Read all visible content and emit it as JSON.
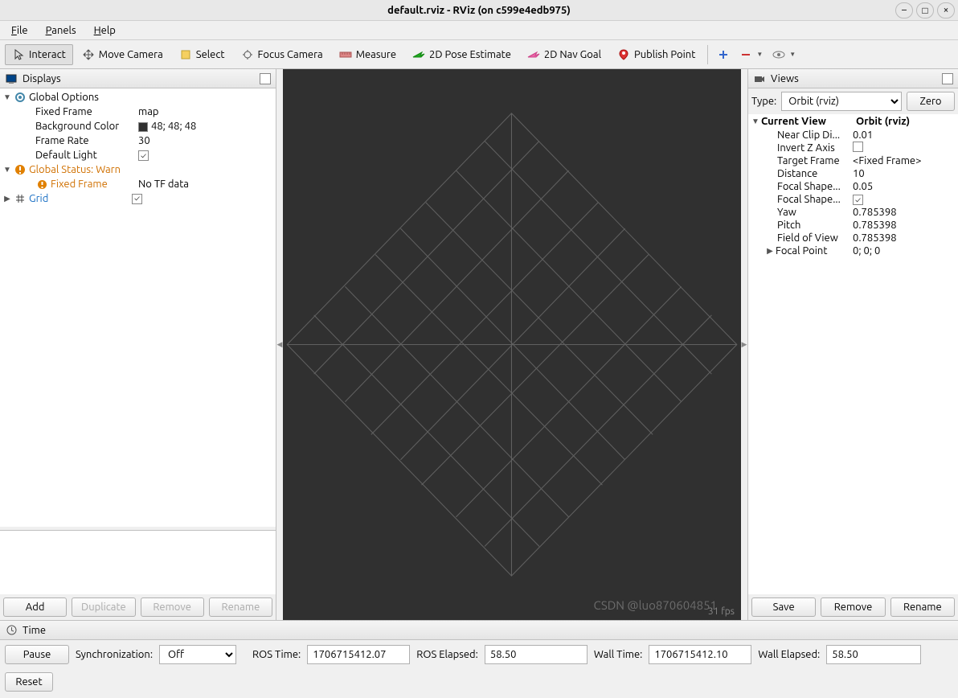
{
  "window": {
    "title": "default.rviz - RViz (on c599e4edb975)"
  },
  "menus": {
    "file": "File",
    "panels": "Panels",
    "help": "Help"
  },
  "toolbar": {
    "interact": "Interact",
    "move_camera": "Move Camera",
    "select": "Select",
    "focus_camera": "Focus Camera",
    "measure": "Measure",
    "pose_estimate": "2D Pose Estimate",
    "nav_goal": "2D Nav Goal",
    "publish_point": "Publish Point"
  },
  "displays": {
    "panel_title": "Displays",
    "global_options": {
      "label": "Global Options",
      "fixed_frame": {
        "label": "Fixed Frame",
        "value": "map"
      },
      "background_color": {
        "label": "Background Color",
        "value": "48; 48; 48"
      },
      "frame_rate": {
        "label": "Frame Rate",
        "value": "30"
      },
      "default_light": {
        "label": "Default Light",
        "checked": true
      }
    },
    "global_status": {
      "label": "Global Status: Warn",
      "fixed_frame": {
        "label": "Fixed Frame",
        "value": "No TF data"
      }
    },
    "grid": {
      "label": "Grid",
      "checked": true
    },
    "buttons": {
      "add": "Add",
      "duplicate": "Duplicate",
      "remove": "Remove",
      "rename": "Rename"
    }
  },
  "views": {
    "panel_title": "Views",
    "type_label": "Type:",
    "type_value": "Orbit (rviz)",
    "zero_btn": "Zero",
    "current_view": {
      "label": "Current View",
      "value": "Orbit (rviz)"
    },
    "props": {
      "near_clip": {
        "label": "Near Clip Di...",
        "value": "0.01"
      },
      "invert_z": {
        "label": "Invert Z Axis",
        "checked": false
      },
      "target_frame": {
        "label": "Target Frame",
        "value": "<Fixed Frame>"
      },
      "distance": {
        "label": "Distance",
        "value": "10"
      },
      "focal_shape_size": {
        "label": "Focal Shape...",
        "value": "0.05"
      },
      "focal_shape_fixed": {
        "label": "Focal Shape...",
        "checked": true
      },
      "yaw": {
        "label": "Yaw",
        "value": "0.785398"
      },
      "pitch": {
        "label": "Pitch",
        "value": "0.785398"
      },
      "fov": {
        "label": "Field of View",
        "value": "0.785398"
      },
      "focal_point": {
        "label": "Focal Point",
        "value": "0; 0; 0"
      }
    },
    "buttons": {
      "save": "Save",
      "remove": "Remove",
      "rename": "Rename"
    }
  },
  "time": {
    "panel_title": "Time",
    "pause": "Pause",
    "sync_label": "Synchronization:",
    "sync_value": "Off",
    "ros_time_label": "ROS Time:",
    "ros_time": "1706715412.07",
    "ros_elapsed_label": "ROS Elapsed:",
    "ros_elapsed": "58.50",
    "wall_time_label": "Wall Time:",
    "wall_time": "1706715412.10",
    "wall_elapsed_label": "Wall Elapsed:",
    "wall_elapsed": "58.50",
    "reset": "Reset"
  },
  "viewport": {
    "fps": "31 fps"
  },
  "watermark": "CSDN @luo870604851"
}
